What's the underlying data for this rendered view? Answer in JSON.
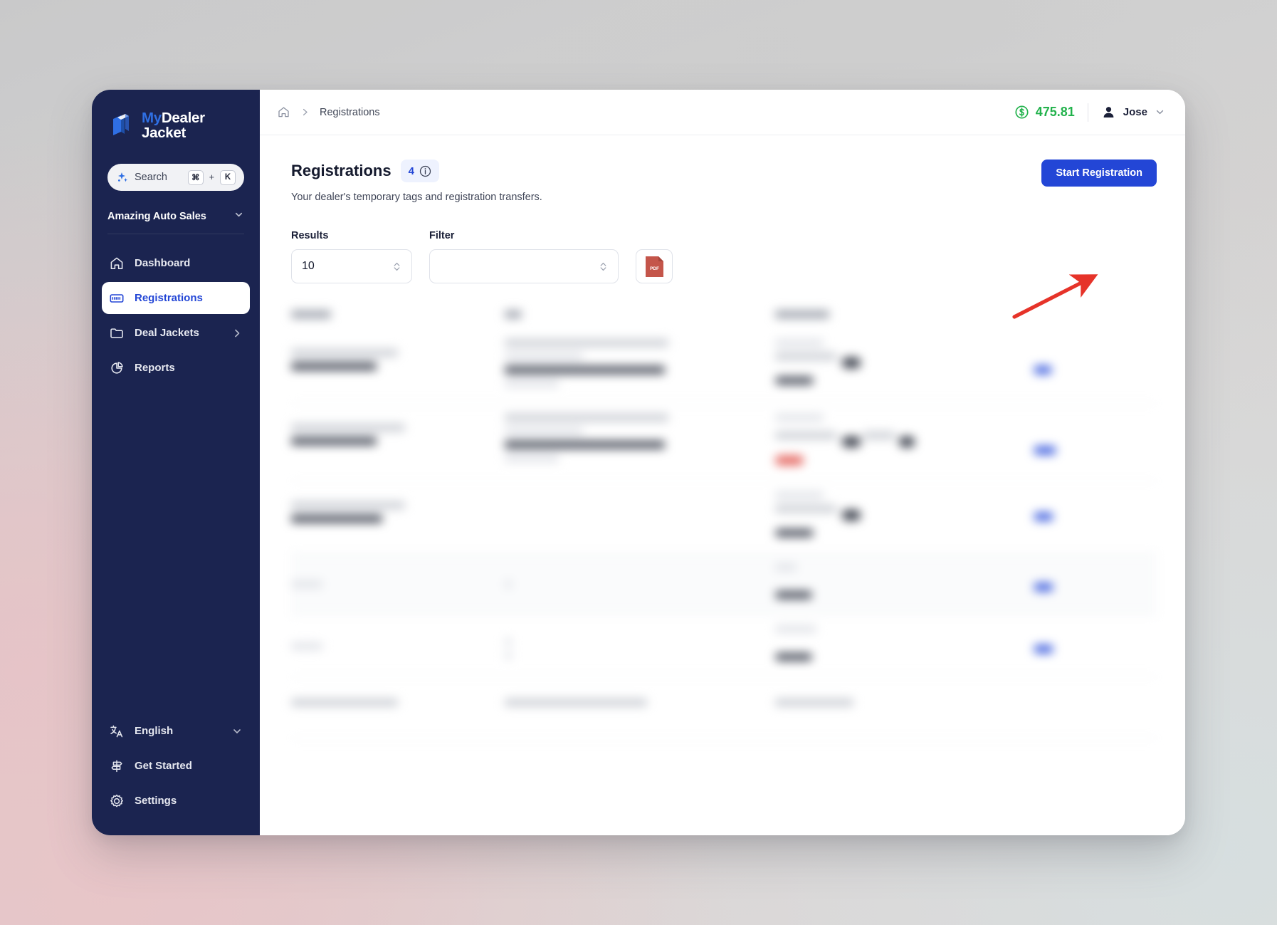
{
  "brand": {
    "logo_line1_accent": "My",
    "logo_line1": "Dealer",
    "logo_line2": "Jacket",
    "logo_icon": "stacked-cards-icon",
    "accent_blue": "#2346d6",
    "sidebar_navy": "#1b2450",
    "money_green": "#22b24c",
    "pdf_red": "#c4554a"
  },
  "sidebar": {
    "search": {
      "icon": "sparkle-icon",
      "label": "Search",
      "key_modifier": "⌘",
      "key_plus": "+",
      "key_letter": "K"
    },
    "dealer": {
      "name": "Amazing Auto Sales",
      "chevron": "chevron-down-icon"
    },
    "items": [
      {
        "label": "Dashboard",
        "icon": "home-icon",
        "active": false,
        "chevron": false
      },
      {
        "label": "Registrations",
        "icon": "license-plate-icon",
        "active": true,
        "chevron": false
      },
      {
        "label": "Deal Jackets",
        "icon": "folder-icon",
        "active": false,
        "chevron": true
      },
      {
        "label": "Reports",
        "icon": "pie-chart-icon",
        "active": false,
        "chevron": false
      }
    ],
    "bottom_items": [
      {
        "label": "English",
        "icon": "translate-icon",
        "chevron": true
      },
      {
        "label": "Get Started",
        "icon": "signpost-icon",
        "chevron": false
      },
      {
        "label": "Settings",
        "icon": "gear-icon",
        "chevron": false
      }
    ]
  },
  "topbar": {
    "breadcrumb": {
      "home_icon": "home-icon",
      "separator_icon": "chevron-right-icon",
      "current": "Registrations"
    },
    "balance": {
      "icon": "dollar-circle-icon",
      "amount": "475.81"
    },
    "user": {
      "avatar_icon": "user-avatar-icon",
      "name": "Jose",
      "chevron": "chevron-down-icon"
    }
  },
  "page": {
    "title": "Registrations",
    "count": "4",
    "info_icon": "info-circle-icon",
    "subtitle": "Your dealer's temporary tags and registration transfers.",
    "primary_action": "Start Registration"
  },
  "filters": {
    "results": {
      "label": "Results",
      "value": "10",
      "stepper_icon": "stepper-chevrons-icon"
    },
    "filter": {
      "label": "Filter",
      "value": "",
      "placeholder": "",
      "stepper_icon": "stepper-chevrons-icon"
    },
    "export": {
      "icon": "pdf-file-icon",
      "label": "PDF"
    }
  },
  "table": {
    "redacted": true,
    "note": "Table content is blurred/redacted in the screenshot",
    "columns": [
      "",
      "",
      "",
      ""
    ]
  },
  "annotation": {
    "arrow": "red-pointer-arrow",
    "points_to": "Start Registration"
  }
}
